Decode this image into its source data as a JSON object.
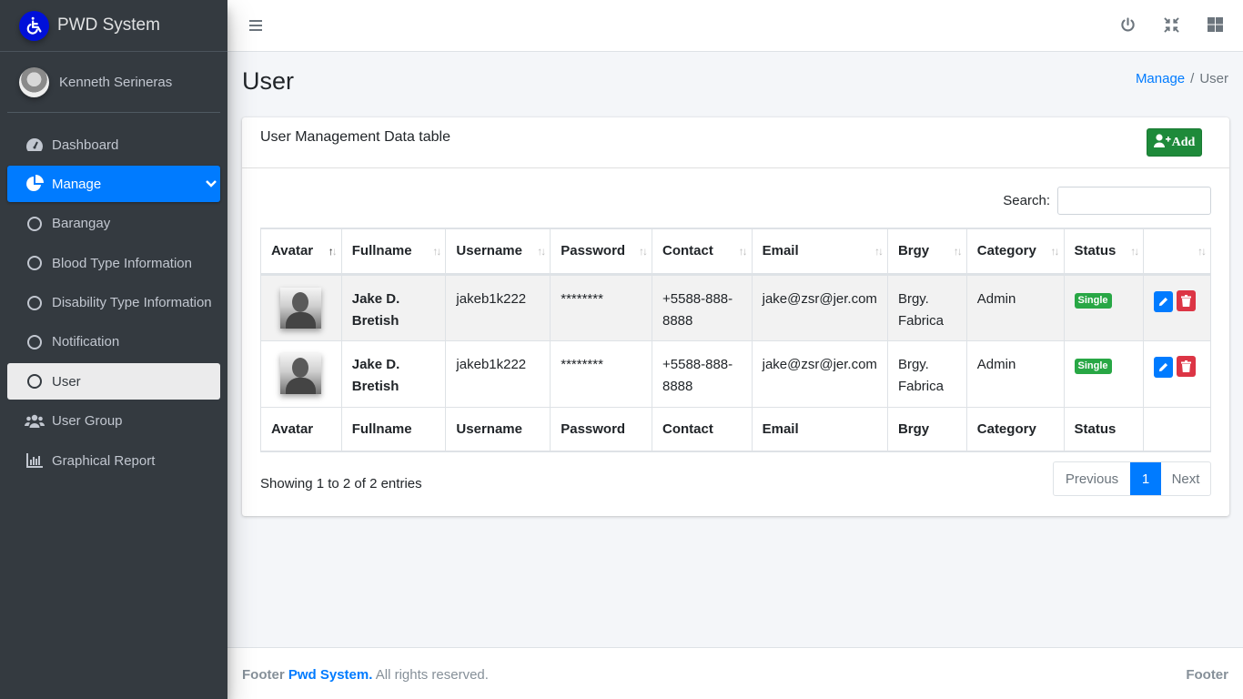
{
  "brand": {
    "name": "PWD System",
    "logo_icon": "wheelchair-icon",
    "logo_color": "#0010d9"
  },
  "user": {
    "name": "Kenneth Serineras"
  },
  "sidebar": {
    "items": [
      {
        "label": "Dashboard",
        "icon": "tachometer-icon",
        "state": "normal"
      },
      {
        "label": "Manage",
        "icon": "pie-chart-icon",
        "state": "active",
        "expanded": true
      },
      {
        "label": "Barangay",
        "icon": "circle-icon",
        "state": "normal"
      },
      {
        "label": "Blood Type Information",
        "icon": "circle-icon",
        "state": "normal"
      },
      {
        "label": "Disability Type Information",
        "icon": "circle-icon",
        "state": "normal"
      },
      {
        "label": "Notification",
        "icon": "circle-icon",
        "state": "normal"
      },
      {
        "label": "User",
        "icon": "circle-icon",
        "state": "selected"
      },
      {
        "label": "User Group",
        "icon": "users-icon",
        "state": "normal"
      },
      {
        "label": "Graphical Report",
        "icon": "bar-chart-icon",
        "state": "normal"
      }
    ]
  },
  "topbar": {
    "icons": [
      "power-icon",
      "compress-icon",
      "grid-icon"
    ]
  },
  "page": {
    "title": "User",
    "breadcrumb": {
      "parent": "Manage",
      "separator": "/",
      "current": "User"
    }
  },
  "card": {
    "title": "User Management Data table",
    "add_label": "Add",
    "search_label": "Search:",
    "search_value": "",
    "columns": [
      "Avatar",
      "Fullname",
      "Username",
      "Password",
      "Contact",
      "Email",
      "Brgy",
      "Category",
      "Status",
      ""
    ],
    "sorted_column": "Avatar",
    "rows": [
      {
        "fullname_1": "Jake D.",
        "fullname_2": "Bretish",
        "username": "jakeb1k222",
        "password": "********",
        "contact_1": "+5588-888-",
        "contact_2": "8888",
        "email": "jake@zsr@jer.com",
        "brgy_1": "Brgy.",
        "brgy_2": "Fabrica",
        "category": "Admin",
        "status": "Single"
      },
      {
        "fullname_1": "Jake D.",
        "fullname_2": "Bretish",
        "username": "jakeb1k222",
        "password": "********",
        "contact_1": "+5588-888-",
        "contact_2": "8888",
        "email": "jake@zsr@jer.com",
        "brgy_1": "Brgy.",
        "brgy_2": "Fabrica",
        "category": "Admin",
        "status": "Single"
      }
    ],
    "info": "Showing 1 to 2 of 2 entries",
    "pagination": {
      "previous": "Previous",
      "current": "1",
      "next": "Next"
    }
  },
  "footer": {
    "prefix": "Footer",
    "brand": "Pwd System.",
    "suffix": "All rights reserved.",
    "right": "Footer"
  },
  "colors": {
    "primary": "#007bff",
    "success": "#28a745",
    "add_button": "#1e8a3a",
    "danger": "#dc3545",
    "sidebar": "#343a40"
  }
}
